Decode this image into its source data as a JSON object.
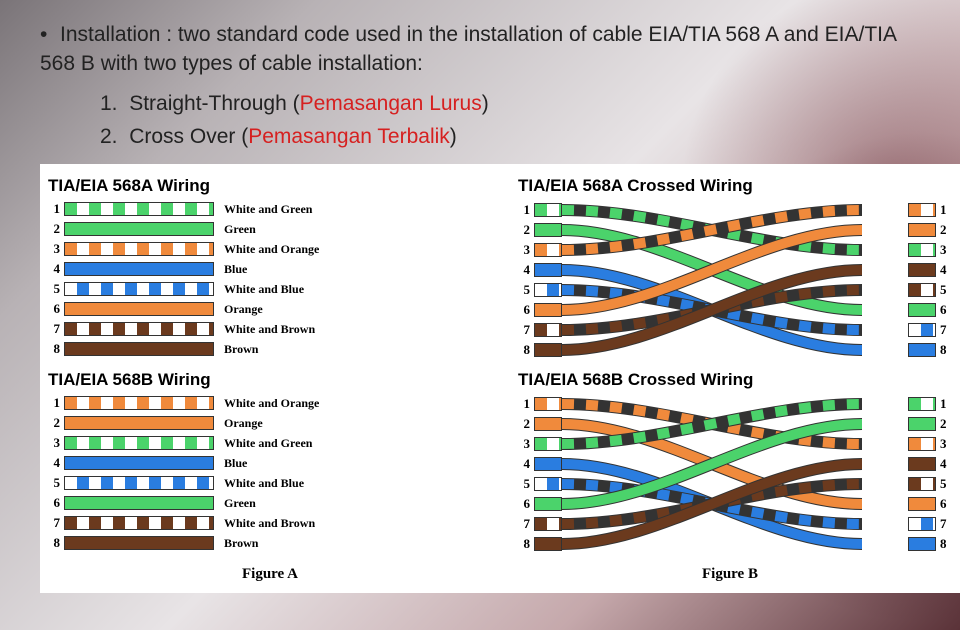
{
  "intro": {
    "line1": "Installation : two standard code used in the installation of cable EIA/TIA 568 A and EIA/TIA 568 B with two types of cable installation:",
    "item1_prefix": "Straight-Through (",
    "item1_red": "Pemasangan Lurus",
    "item1_suffix": ")",
    "item2_prefix": "Cross Over (",
    "item2_red": "Pemasangan Terbalik",
    "item2_suffix": ")"
  },
  "panels": {
    "a": {
      "title": "TIA/EIA 568A Wiring",
      "wires": [
        {
          "n": "1",
          "cls": "s-green",
          "label": "White and Green"
        },
        {
          "n": "2",
          "cls": "c-green",
          "label": "Green"
        },
        {
          "n": "3",
          "cls": "s-orange",
          "label": "White and Orange"
        },
        {
          "n": "4",
          "cls": "c-blue",
          "label": "Blue"
        },
        {
          "n": "5",
          "cls": "s-blue",
          "label": "White and Blue"
        },
        {
          "n": "6",
          "cls": "c-orange",
          "label": "Orange"
        },
        {
          "n": "7",
          "cls": "s-brown",
          "label": "White and Brown"
        },
        {
          "n": "8",
          "cls": "c-brown",
          "label": "Brown"
        }
      ]
    },
    "b": {
      "title": "TIA/EIA 568B Wiring",
      "wires": [
        {
          "n": "1",
          "cls": "s-orange",
          "label": "White and Orange"
        },
        {
          "n": "2",
          "cls": "c-orange",
          "label": "Orange"
        },
        {
          "n": "3",
          "cls": "s-green",
          "label": "White and Green"
        },
        {
          "n": "4",
          "cls": "c-blue",
          "label": "Blue"
        },
        {
          "n": "5",
          "cls": "s-blue",
          "label": "White and Blue"
        },
        {
          "n": "6",
          "cls": "c-green",
          "label": "Green"
        },
        {
          "n": "7",
          "cls": "s-brown",
          "label": "White and Brown"
        },
        {
          "n": "8",
          "cls": "c-brown",
          "label": "Brown"
        }
      ]
    },
    "a_cross": {
      "title": "TIA/EIA 568A Crossed Wiring",
      "left": [
        {
          "n": "1",
          "cls": "s-green"
        },
        {
          "n": "2",
          "cls": "c-green"
        },
        {
          "n": "3",
          "cls": "s-orange"
        },
        {
          "n": "4",
          "cls": "c-blue"
        },
        {
          "n": "5",
          "cls": "s-blue"
        },
        {
          "n": "6",
          "cls": "c-orange"
        },
        {
          "n": "7",
          "cls": "s-brown"
        },
        {
          "n": "8",
          "cls": "c-brown"
        }
      ],
      "right": [
        {
          "n": "1",
          "cls": "s-orange"
        },
        {
          "n": "2",
          "cls": "c-orange"
        },
        {
          "n": "3",
          "cls": "s-green"
        },
        {
          "n": "4",
          "cls": "c-brown"
        },
        {
          "n": "5",
          "cls": "s-brown"
        },
        {
          "n": "6",
          "cls": "c-green"
        },
        {
          "n": "7",
          "cls": "s-blue"
        },
        {
          "n": "8",
          "cls": "c-blue"
        }
      ],
      "map": [
        [
          1,
          3
        ],
        [
          2,
          6
        ],
        [
          3,
          1
        ],
        [
          4,
          8
        ],
        [
          5,
          7
        ],
        [
          6,
          2
        ],
        [
          7,
          5
        ],
        [
          8,
          4
        ]
      ]
    },
    "b_cross": {
      "title": "TIA/EIA 568B Crossed Wiring",
      "left": [
        {
          "n": "1",
          "cls": "s-orange"
        },
        {
          "n": "2",
          "cls": "c-orange"
        },
        {
          "n": "3",
          "cls": "s-green"
        },
        {
          "n": "4",
          "cls": "c-blue"
        },
        {
          "n": "5",
          "cls": "s-blue"
        },
        {
          "n": "6",
          "cls": "c-green"
        },
        {
          "n": "7",
          "cls": "s-brown"
        },
        {
          "n": "8",
          "cls": "c-brown"
        }
      ],
      "right": [
        {
          "n": "1",
          "cls": "s-green"
        },
        {
          "n": "2",
          "cls": "c-green"
        },
        {
          "n": "3",
          "cls": "s-orange"
        },
        {
          "n": "4",
          "cls": "c-brown"
        },
        {
          "n": "5",
          "cls": "s-brown"
        },
        {
          "n": "6",
          "cls": "c-orange"
        },
        {
          "n": "7",
          "cls": "s-blue"
        },
        {
          "n": "8",
          "cls": "c-blue"
        }
      ],
      "map": [
        [
          1,
          3
        ],
        [
          2,
          6
        ],
        [
          3,
          1
        ],
        [
          4,
          8
        ],
        [
          5,
          7
        ],
        [
          6,
          2
        ],
        [
          7,
          5
        ],
        [
          8,
          4
        ]
      ]
    }
  },
  "captions": {
    "a": "Figure A",
    "b": "Figure B"
  },
  "colors": {
    "s-green": "#4bd36b",
    "c-green": "#4bd36b",
    "s-orange": "#f08a3c",
    "c-orange": "#f08a3c",
    "s-blue": "#2a7de0",
    "c-blue": "#2a7de0",
    "s-brown": "#6b3a1e",
    "c-brown": "#6b3a1e"
  }
}
